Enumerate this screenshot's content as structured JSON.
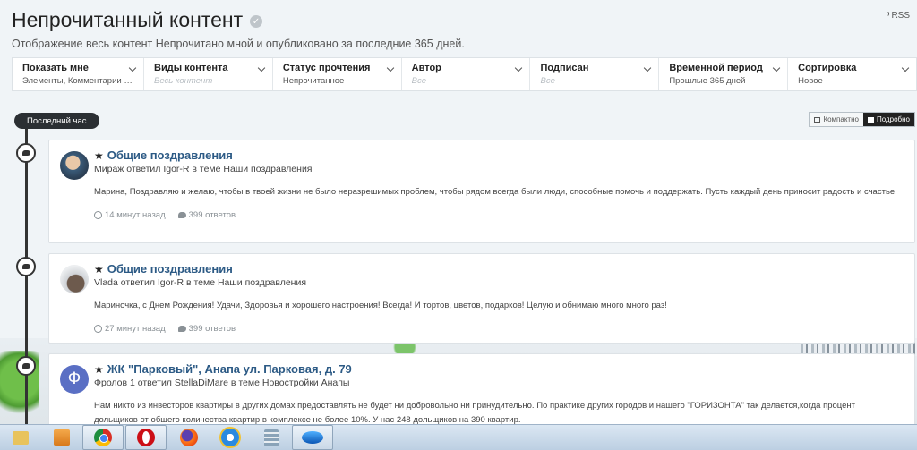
{
  "header": {
    "title": "Непрочитанный контент",
    "subtitle": "Отображение весь контент Непрочитано мной и опубликовано за последние 365 дней.",
    "rss_label": "RSS"
  },
  "filters": [
    {
      "label": "Показать мне",
      "value": "Элементы, Комментарии и ...",
      "placeholder": false
    },
    {
      "label": "Виды контента",
      "value": "Весь контент",
      "placeholder": true
    },
    {
      "label": "Статус прочтения",
      "value": "Непрочитанное",
      "placeholder": false
    },
    {
      "label": "Автор",
      "value": "Все",
      "placeholder": true
    },
    {
      "label": "Подписан",
      "value": "Все",
      "placeholder": true
    },
    {
      "label": "Временной период",
      "value": "Прошлые 365 дней",
      "placeholder": false
    },
    {
      "label": "Сортировка",
      "value": "Новое",
      "placeholder": false
    }
  ],
  "timeline": {
    "period_label": "Последний час"
  },
  "view_toggle": {
    "compact_label": "Компактно",
    "detailed_label": "Подробно",
    "active": "detailed"
  },
  "items": [
    {
      "title": "Общие поздравления",
      "meta": "Мираж ответил Igor-R в теме Наши поздравления",
      "text": "Марина, Поздравляю и желаю, чтобы в твоей жизни не было неразрешимых проблем, чтобы рядом всегда были люди, способные помочь и поддержать. Пусть каждый день приносит радость и счастье!",
      "time": "14 минут назад",
      "replies": "399 ответов"
    },
    {
      "title": "Общие поздравления",
      "meta": "Vlada ответил Igor-R в теме Наши поздравления",
      "text": "Мариночка, с Днем Рождения! Удачи, Здоровья и хорошего настроения! Всегда! И тортов, цветов, подарков! Целую и обнимаю много много раз!",
      "time": "27 минут назад",
      "replies": "399 ответов"
    },
    {
      "title": "ЖК \"Парковый\", Анапа ул. Парковая, д. 79",
      "avatar_letter": "Ф",
      "meta": "Фролов 1 ответил StellaDiMare в теме Новостройки Анапы",
      "text": "Нам никто из инвесторов квартиры в других домах предоставлять не будет ни добровольно ни принудительно. По практике других городов и нашего \"ГОРИЗОНТА\" так делается,когда процент дольщиков от общего количества квартир в комплексе не более 10%. У нас 248 дольщиков на 390 квартир."
    }
  ],
  "taskbar": {
    "icons": [
      "folder-icon",
      "media-player-icon",
      "chrome-icon",
      "opera-icon",
      "firefox-icon",
      "internet-explorer-icon",
      "calculator-icon",
      "app-icon"
    ]
  }
}
